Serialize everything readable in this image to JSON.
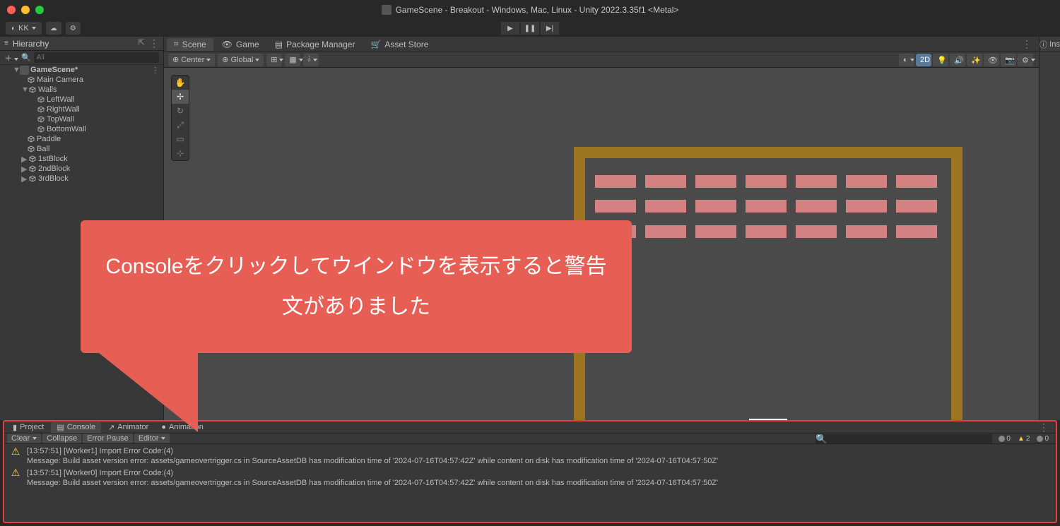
{
  "titlebar": {
    "title": "GameScene - Breakout - Windows, Mac, Linux - Unity 2022.3.35f1 <Metal>"
  },
  "account": {
    "label": "KK"
  },
  "hierarchy": {
    "title": "Hierarchy",
    "search_placeholder": "All",
    "scene": "GameScene*",
    "nodes": {
      "main_camera": "Main Camera",
      "walls": "Walls",
      "leftwall": "LeftWall",
      "rightwall": "RightWall",
      "topwall": "TopWall",
      "bottomwall": "BottomWall",
      "paddle": "Paddle",
      "ball": "Ball",
      "block1": "1stBlock",
      "block2": "2ndBlock",
      "block3": "3rdBlock"
    }
  },
  "scene_tabs": {
    "scene": "Scene",
    "game": "Game",
    "package_manager": "Package Manager",
    "asset_store": "Asset Store"
  },
  "scene_toolbar": {
    "center": "Center",
    "global": "Global",
    "twod": "2D"
  },
  "inspector": {
    "label": "Ins"
  },
  "callout": {
    "text": "Consoleをクリックしてウインドウを表示すると警告文がありました"
  },
  "console": {
    "tabs": {
      "project": "Project",
      "console": "Console",
      "animator": "Animator",
      "animation": "Animation"
    },
    "toolbar": {
      "clear": "Clear",
      "collapse": "Collapse",
      "error_pause": "Error Pause",
      "editor": "Editor"
    },
    "counts": {
      "log": "0",
      "warn": "2",
      "error": "0"
    },
    "logs": [
      {
        "line1": "[13:57:51] [Worker1] Import Error Code:(4)",
        "line2": "Message: Build asset version error: assets/gameovertrigger.cs in SourceAssetDB has modification time of '2024-07-16T04:57:42Z' while content on disk has modification time of '2024-07-16T04:57:50Z'"
      },
      {
        "line1": "[13:57:51] [Worker0] Import Error Code:(4)",
        "line2": "Message: Build asset version error: assets/gameovertrigger.cs in SourceAssetDB has modification time of '2024-07-16T04:57:42Z' while content on disk has modification time of '2024-07-16T04:57:50Z'"
      }
    ]
  }
}
